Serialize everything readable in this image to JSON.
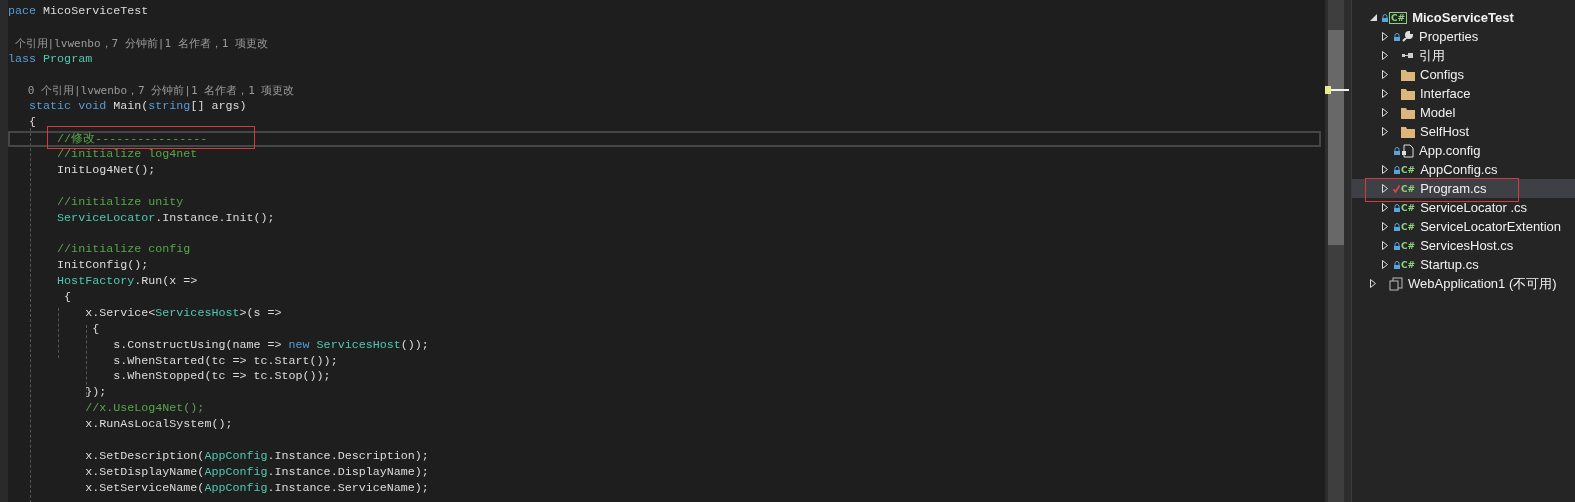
{
  "editor": {
    "lines": [
      {
        "kind": "code",
        "tokens": [
          {
            "kind": "keyword",
            "text": "pace"
          },
          {
            "kind": "plain",
            "text": " MicoServiceTest"
          }
        ]
      },
      {
        "kind": "blank"
      },
      {
        "kind": "lens",
        "text": " 个引用|lvwenbo，7 分钟前|1 名作者，1 项更改"
      },
      {
        "kind": "code",
        "tokens": [
          {
            "kind": "keyword",
            "text": "lass "
          },
          {
            "kind": "type",
            "text": "Program"
          }
        ]
      },
      {
        "kind": "blank"
      },
      {
        "kind": "lens",
        "text": "   0 个引用|lvwenbo，7 分钟前|1 名作者，1 项更改"
      },
      {
        "kind": "code",
        "tokens": [
          {
            "kind": "keyword",
            "text": "   static void"
          },
          {
            "kind": "plain",
            "text": " Main("
          },
          {
            "kind": "keyword",
            "text": "string"
          },
          {
            "kind": "plain",
            "text": "[] args)"
          }
        ]
      },
      {
        "kind": "code",
        "tokens": [
          {
            "kind": "plain",
            "text": "   {"
          }
        ]
      },
      {
        "kind": "code",
        "current": true,
        "annotated": true,
        "tokens": [
          {
            "kind": "comment",
            "text": "       //修改----------------"
          }
        ]
      },
      {
        "kind": "code",
        "tokens": [
          {
            "kind": "comment",
            "text": "       //initialize log4net"
          }
        ]
      },
      {
        "kind": "code",
        "tokens": [
          {
            "kind": "plain",
            "text": "       InitLog4Net();"
          }
        ]
      },
      {
        "kind": "blank"
      },
      {
        "kind": "code",
        "tokens": [
          {
            "kind": "comment",
            "text": "       //initialize unity"
          }
        ]
      },
      {
        "kind": "code",
        "tokens": [
          {
            "kind": "type",
            "text": "       ServiceLocator"
          },
          {
            "kind": "plain",
            "text": ".Instance.Init();"
          }
        ]
      },
      {
        "kind": "blank"
      },
      {
        "kind": "code",
        "tokens": [
          {
            "kind": "comment",
            "text": "       //initialize config"
          }
        ]
      },
      {
        "kind": "code",
        "tokens": [
          {
            "kind": "plain",
            "text": "       InitConfig();"
          }
        ]
      },
      {
        "kind": "code",
        "tokens": [
          {
            "kind": "type",
            "text": "       HostFactory"
          },
          {
            "kind": "plain",
            "text": ".Run(x =>"
          }
        ]
      },
      {
        "kind": "code",
        "tokens": [
          {
            "kind": "plain",
            "text": "        {"
          }
        ]
      },
      {
        "kind": "code",
        "tokens": [
          {
            "kind": "plain",
            "text": "           x.Service<"
          },
          {
            "kind": "type",
            "text": "ServicesHost"
          },
          {
            "kind": "plain",
            "text": ">(s =>"
          }
        ]
      },
      {
        "kind": "code",
        "tokens": [
          {
            "kind": "plain",
            "text": "            {"
          }
        ]
      },
      {
        "kind": "code",
        "tokens": [
          {
            "kind": "plain",
            "text": "               s.ConstructUsing(name => "
          },
          {
            "kind": "keyword",
            "text": "new "
          },
          {
            "kind": "type",
            "text": "ServicesHost"
          },
          {
            "kind": "plain",
            "text": "());"
          }
        ]
      },
      {
        "kind": "code",
        "tokens": [
          {
            "kind": "plain",
            "text": "               s.WhenStarted(tc => tc.Start());"
          }
        ]
      },
      {
        "kind": "code",
        "tokens": [
          {
            "kind": "plain",
            "text": "               s.WhenStopped(tc => tc.Stop());"
          }
        ]
      },
      {
        "kind": "code",
        "tokens": [
          {
            "kind": "plain",
            "text": "           });"
          }
        ]
      },
      {
        "kind": "code",
        "tokens": [
          {
            "kind": "comment",
            "text": "           //x.UseLog4Net();"
          }
        ]
      },
      {
        "kind": "code",
        "tokens": [
          {
            "kind": "plain",
            "text": "           x.RunAsLocalSystem();"
          }
        ]
      },
      {
        "kind": "blank"
      },
      {
        "kind": "code",
        "tokens": [
          {
            "kind": "plain",
            "text": "           x.SetDescription("
          },
          {
            "kind": "type",
            "text": "AppConfig"
          },
          {
            "kind": "plain",
            "text": ".Instance.Description);"
          }
        ]
      },
      {
        "kind": "code",
        "tokens": [
          {
            "kind": "plain",
            "text": "           x.SetDisplayName("
          },
          {
            "kind": "type",
            "text": "AppConfig"
          },
          {
            "kind": "plain",
            "text": ".Instance.DisplayName);"
          }
        ]
      },
      {
        "kind": "code",
        "tokens": [
          {
            "kind": "plain",
            "text": "           x.SetServiceName("
          },
          {
            "kind": "type",
            "text": "AppConfig"
          },
          {
            "kind": "plain",
            "text": ".Instance.ServiceName);"
          }
        ]
      }
    ]
  },
  "solution_explorer": {
    "items": [
      {
        "kind": "project",
        "label": "MicoServiceTest",
        "badge": "C#",
        "locked": true,
        "modified": false,
        "expandable": true,
        "expanded": true,
        "selected": false,
        "children": [
          {
            "kind": "properties",
            "label": "Properties",
            "locked": true,
            "modified": false,
            "expandable": true,
            "expanded": false,
            "selected": false
          },
          {
            "kind": "references",
            "label": "引用",
            "locked": false,
            "modified": false,
            "expandable": true,
            "expanded": false,
            "selected": false
          },
          {
            "kind": "folder",
            "label": "Configs",
            "locked": false,
            "modified": false,
            "expandable": true,
            "expanded": false,
            "selected": false
          },
          {
            "kind": "folder",
            "label": "Interface",
            "locked": false,
            "modified": false,
            "expandable": true,
            "expanded": false,
            "selected": false
          },
          {
            "kind": "folder",
            "label": "Model",
            "locked": false,
            "modified": false,
            "expandable": true,
            "expanded": false,
            "selected": false
          },
          {
            "kind": "folder",
            "label": "SelfHost",
            "locked": false,
            "modified": false,
            "expandable": true,
            "expanded": false,
            "selected": false
          },
          {
            "kind": "config",
            "label": "App.config",
            "locked": true,
            "modified": false,
            "expandable": false,
            "selected": false
          },
          {
            "kind": "csharp",
            "label": "AppConfig.cs",
            "badge": "C#",
            "locked": true,
            "modified": false,
            "expandable": true,
            "expanded": false,
            "selected": false
          },
          {
            "kind": "csharp",
            "label": "Program.cs",
            "badge": "C#",
            "locked": false,
            "modified": true,
            "expandable": true,
            "expanded": false,
            "selected": true,
            "annotated": true
          },
          {
            "kind": "csharp",
            "label": "ServiceLocator .cs",
            "badge": "C#",
            "locked": true,
            "modified": false,
            "expandable": true,
            "expanded": false,
            "selected": false
          },
          {
            "kind": "csharp",
            "label": "ServiceLocatorExtention",
            "badge": "C#",
            "locked": true,
            "modified": false,
            "expandable": true,
            "expanded": false,
            "selected": false
          },
          {
            "kind": "csharp",
            "label": "ServicesHost.cs",
            "badge": "C#",
            "locked": true,
            "modified": false,
            "expandable": true,
            "expanded": false,
            "selected": false
          },
          {
            "kind": "csharp",
            "label": "Startup.cs",
            "badge": "C#",
            "locked": true,
            "modified": false,
            "expandable": true,
            "expanded": false,
            "selected": false
          }
        ]
      },
      {
        "kind": "unloaded",
        "label": "WebApplication1 (不可用)",
        "locked": false,
        "modified": false,
        "expandable": true,
        "expanded": false,
        "selected": false
      }
    ]
  }
}
